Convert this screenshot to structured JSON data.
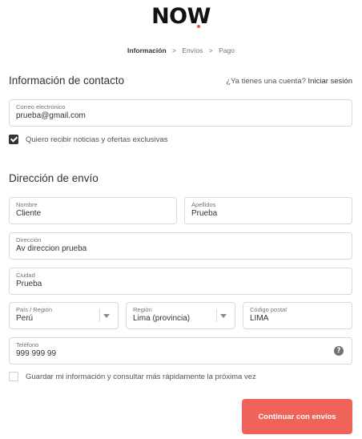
{
  "brand": {
    "logo": "NOW",
    "accent_color": "#e8574a"
  },
  "breadcrumb": {
    "steps": [
      "Información",
      "Envíos",
      "Pago"
    ],
    "separator": ">"
  },
  "contact": {
    "title": "Información de contacto",
    "login_prompt": "¿Ya tienes una cuenta?",
    "login_link": "Iniciar sesión",
    "email_label": "Correo electrónico",
    "email_value": "prueba@gmail.com",
    "newsletter_label": "Quiero recibir noticias y ofertas exclusivas",
    "newsletter_checked": true
  },
  "shipping": {
    "title": "Dirección de envío",
    "first_name": {
      "label": "Nombre",
      "value": "Cliente"
    },
    "last_name": {
      "label": "Apellidos",
      "value": "Prueba"
    },
    "address": {
      "label": "Dirección",
      "value": "Av direccion prueba"
    },
    "city": {
      "label": "Ciudad",
      "value": "Prueba"
    },
    "country": {
      "label": "País / Región",
      "value": "Perú"
    },
    "region": {
      "label": "Región",
      "value": "Lima (provincia)"
    },
    "postal": {
      "label": "Código postal",
      "value": "LIMA"
    },
    "phone": {
      "label": "Teléfono",
      "value": "999 999 99",
      "help_icon": "?"
    },
    "save_info_label": "Guardar mi información y consultar más rápidamente la próxima vez",
    "save_info_checked": false
  },
  "actions": {
    "continue_label": "Continuar con envíos",
    "button_color": "#f0635b"
  }
}
